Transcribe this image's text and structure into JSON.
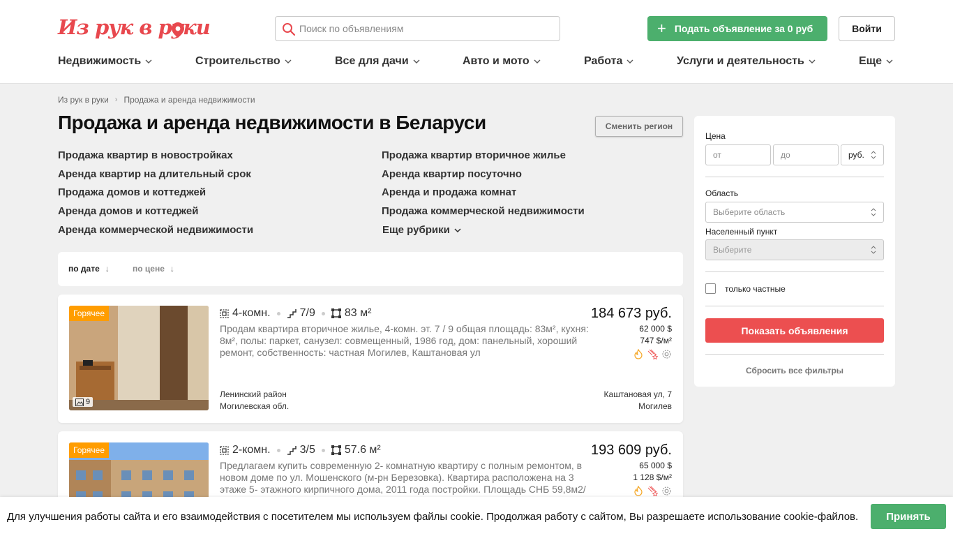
{
  "header": {
    "logo_text": "Из рук в руки",
    "search_placeholder": "Поиск по объявлениям",
    "post_button": "Подать объявление за 0 руб",
    "login_button": "Войти",
    "brand_color": "#e8484e",
    "accent_green": "#4caf6d"
  },
  "nav": [
    {
      "label": "Недвижимость"
    },
    {
      "label": "Строительство"
    },
    {
      "label": "Все для дачи"
    },
    {
      "label": "Авто и мото"
    },
    {
      "label": "Работа"
    },
    {
      "label": "Услуги и деятельность"
    },
    {
      "label": "Еще"
    }
  ],
  "breadcrumbs": [
    "Из рук в руки",
    "Продажа и аренда недвижимости"
  ],
  "page": {
    "title": "Продажа и аренда недвижимости в Беларуси",
    "region_button": "Сменить регион"
  },
  "rubrics": {
    "left": [
      "Продажа квартир в новостройках",
      "Аренда квартир на длительный срок",
      "Продажа домов и коттеджей",
      "Аренда домов и коттеджей",
      "Аренда коммерческой недвижимости"
    ],
    "right": [
      "Продажа квартир вторичное жилье",
      "Аренда квартир посуточно",
      "Аренда и продажа комнат",
      "Продажа коммерческой недвижимости"
    ],
    "more": "Еще рубрики"
  },
  "sort": {
    "by_date": "по дате",
    "by_price": "по цене"
  },
  "listings": [
    {
      "badge": "Горячее",
      "photos": "9",
      "rooms": "4-комн.",
      "floor": "7/9",
      "area": "83 м²",
      "description": "Продам квартира вторичное жилье, 4-комн. эт. 7 / 9 общая площадь: 83м², кухня: 8м², полы: паркет, санузел: совмещенный, 1986 год, дом: панельный, хороший ремонт, собственность: частная Могилев, Каштановая ул",
      "price_main": "184 673 руб.",
      "price_usd": "62 000 $",
      "price_per_m2": "747 $/м²",
      "district": "Ленинский район",
      "region": "Могилевская обл.",
      "street": "Каштановая ул, 7",
      "city": "Могилев"
    },
    {
      "badge": "Горячее",
      "rooms": "2-комн.",
      "floor": "3/5",
      "area": "57.6 м²",
      "description": "Предлагаем купить современную 2- комнатную квартиру с полным ремонтом, в новом доме по ул. Мошенского (м-рн Березовка). Квартира расположена на 3 этаже 5- этажного кирпичного дома, 2011 года постройки. Площадь СНБ 59,8м2/",
      "price_main": "193 609 руб.",
      "price_usd": "65 000 $",
      "price_per_m2": "1 128 $/м²"
    }
  ],
  "filter": {
    "price_label": "Цена",
    "from_placeholder": "от",
    "to_placeholder": "до",
    "currency": "руб.",
    "region_label": "Область",
    "region_placeholder": "Выберите область",
    "city_label": "Населенный пункт",
    "city_placeholder": "Выберите",
    "private_only": "только частные",
    "show_button": "Показать объявления",
    "reset": "Сбросить все фильтры"
  },
  "cookie": {
    "text": "Для улучшения работы сайта и его взаимодействия с посетителем мы используем файлы cookie. Продолжая работу с сайтом, Вы разрешаете использование cookie-файлов.",
    "accept": "Принять"
  }
}
